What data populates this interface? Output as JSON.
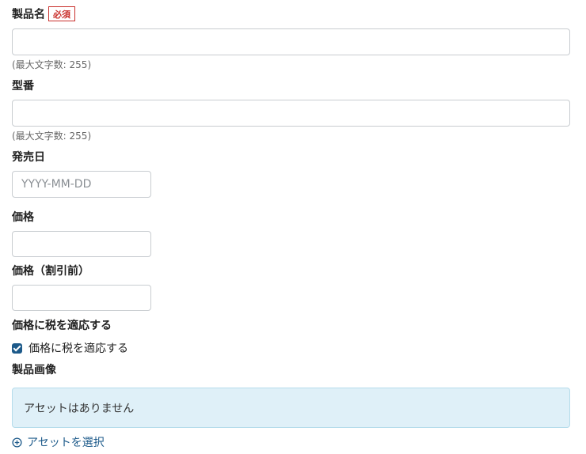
{
  "fields": {
    "product_name": {
      "label": "製品名",
      "required_badge": "必須",
      "value": "",
      "help": "(最大文字数: 255)"
    },
    "model_number": {
      "label": "型番",
      "value": "",
      "help": "(最大文字数: 255)"
    },
    "release_date": {
      "label": "発売日",
      "value": "",
      "placeholder": "YYYY-MM-DD"
    },
    "price": {
      "label": "価格",
      "value": ""
    },
    "price_before_discount": {
      "label": "価格（割引前）",
      "value": ""
    },
    "apply_tax": {
      "label": "価格に税を適応する",
      "checkbox_label": "価格に税を適応する",
      "checked": true
    },
    "product_image": {
      "label": "製品画像",
      "empty_message": "アセットはありません",
      "select_link": "アセットを選択",
      "icon": "plus-circle-icon"
    }
  },
  "colors": {
    "accent": "#1d5a8a",
    "required": "#c9302c",
    "info_bg": "#dff0f8",
    "info_border": "#b5dceb"
  }
}
